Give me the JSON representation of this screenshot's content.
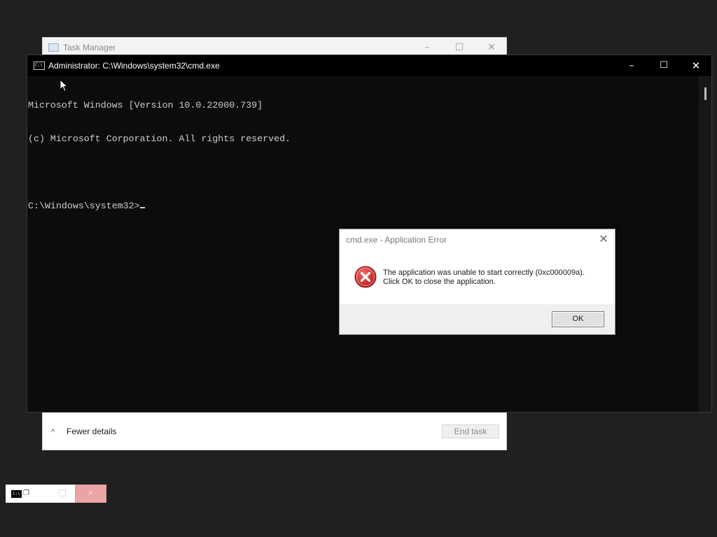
{
  "task_manager": {
    "title": "Task Manager",
    "minimize": "–",
    "maximize": "☐",
    "close": "✕",
    "fewer_details_chevron": "^",
    "fewer_details": "Fewer details",
    "end_task": "End task"
  },
  "cmd": {
    "title": "Administrator: C:\\Windows\\system32\\cmd.exe",
    "icon_text": "C:\\",
    "minimize": "–",
    "maximize": "☐",
    "close": "✕",
    "lines": [
      "Microsoft Windows [Version 10.0.22000.739]",
      "(c) Microsoft Corporation. All rights reserved.",
      "",
      "C:\\Windows\\system32>"
    ]
  },
  "error_dialog": {
    "title": "cmd.exe - Application Error",
    "close": "✕",
    "message_line1": "The application was unable to start correctly (0xc000009a).",
    "message_line2": "Click OK to close the application.",
    "ok_label": "OK",
    "icon": "error-x-icon",
    "icon_color": "#d32f2f"
  },
  "mini_preview": {
    "icon_text": "C:\\",
    "restore": "❐",
    "close": "✕"
  }
}
